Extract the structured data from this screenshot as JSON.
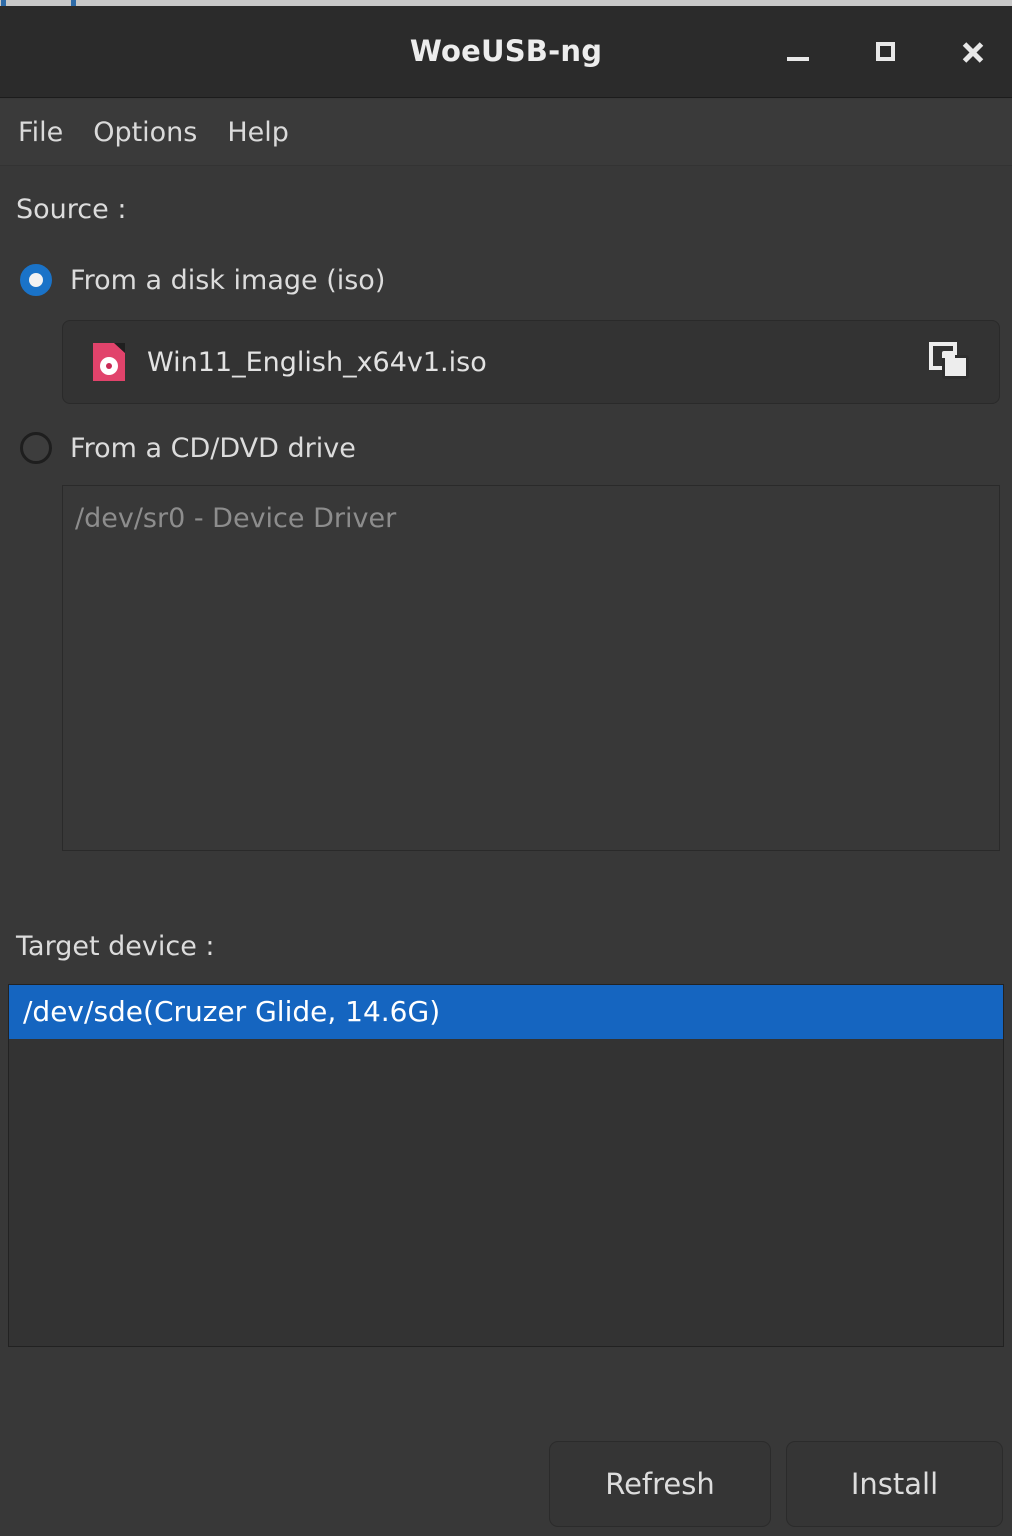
{
  "window": {
    "title": "WoeUSB-ng",
    "controls": {
      "minimize": "minimize-button",
      "maximize": "maximize-button",
      "close": "close-button"
    }
  },
  "menubar": {
    "items": [
      {
        "label": "File"
      },
      {
        "label": "Options"
      },
      {
        "label": "Help"
      }
    ]
  },
  "source": {
    "label": "Source :",
    "options": [
      {
        "label": "From a disk image (iso)",
        "selected": true
      },
      {
        "label": "From a CD/DVD drive",
        "selected": false
      }
    ],
    "iso_field": {
      "filename": "Win11_English_x64v1.iso",
      "icon": "iso-disc-icon",
      "browse_icon": "browse-folder-icon"
    },
    "cd_list": {
      "items": [
        {
          "label": "/dev/sr0 - Device Driver",
          "enabled": false
        }
      ]
    }
  },
  "target": {
    "label": "Target device :",
    "list": {
      "items": [
        {
          "label": "/dev/sde(Cruzer Glide, 14.6G)",
          "selected": true
        }
      ]
    }
  },
  "actions": {
    "refresh_label": "Refresh",
    "install_label": "Install"
  },
  "colors": {
    "window_bg": "#383838",
    "titlebar_bg": "#2b2b2b",
    "accent_blue": "#1565c0",
    "radio_blue": "#1a73c8",
    "iso_icon_red": "#e1436b",
    "disabled_text": "#8d8d8d"
  }
}
